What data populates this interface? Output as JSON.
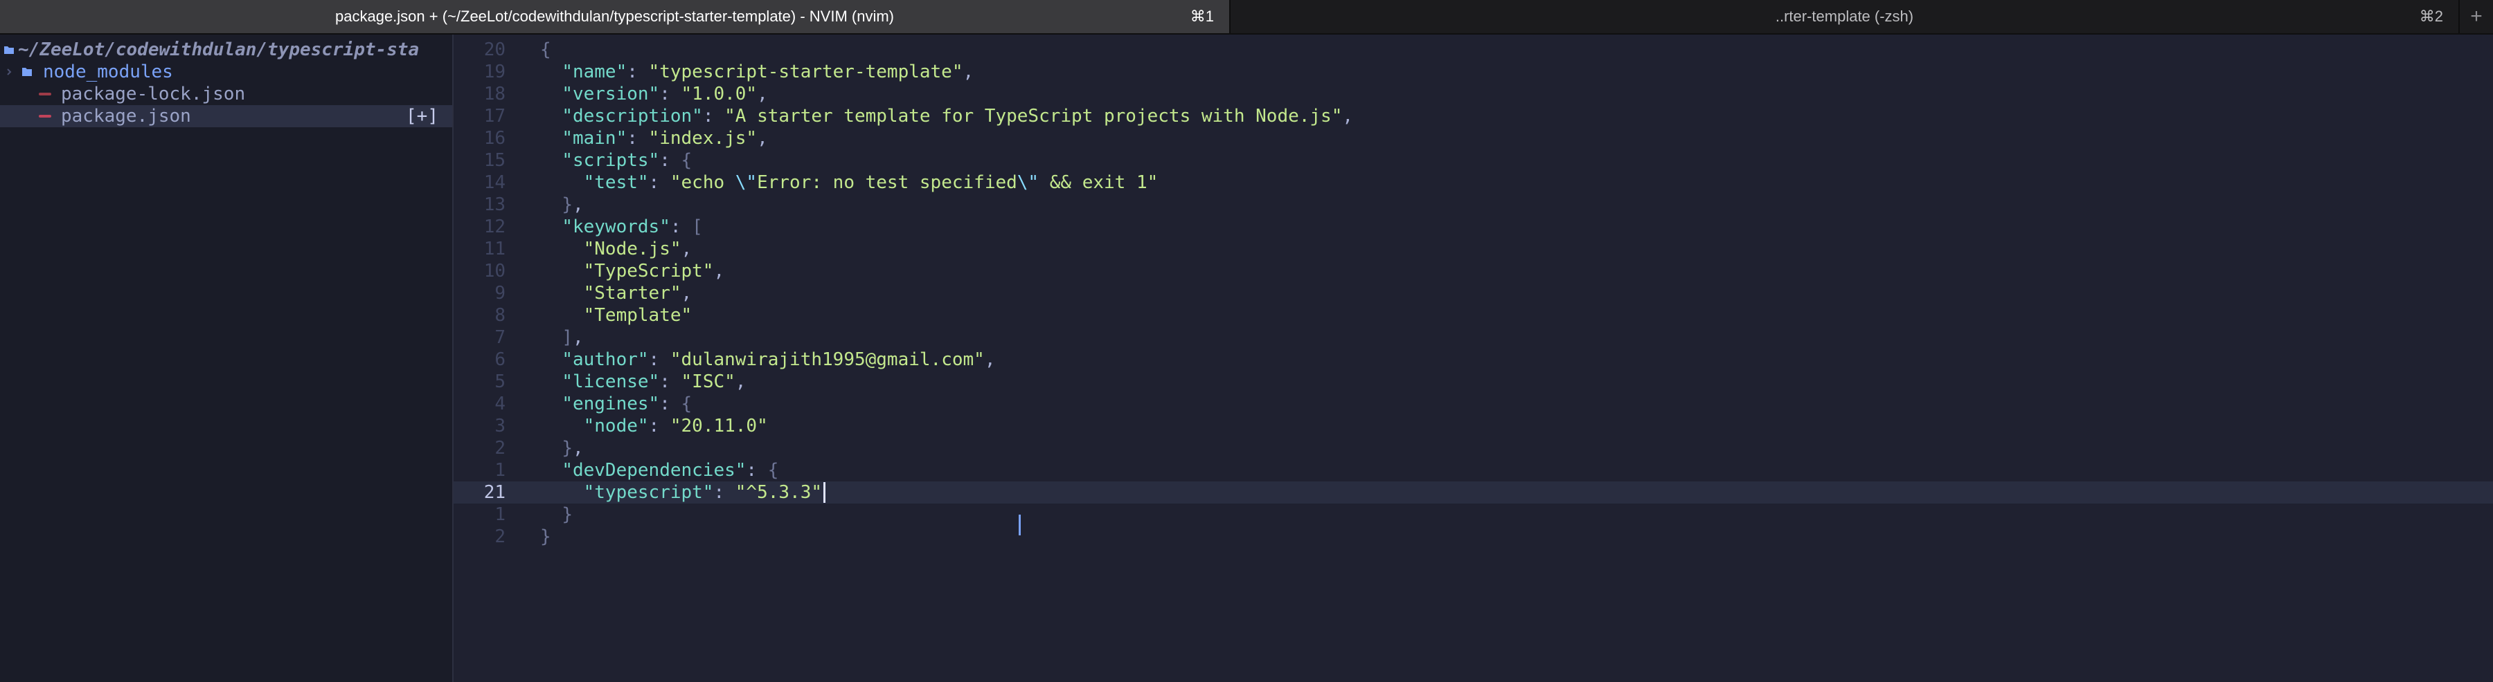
{
  "tabs": [
    {
      "title": "package.json + (~/ZeeLot/codewithdulan/typescript-starter-template) - NVIM (nvim)",
      "shortcut": "⌘1"
    },
    {
      "title": "..rter-template (-zsh)",
      "shortcut": "⌘2"
    }
  ],
  "new_tab": "+",
  "sidebar": {
    "root_path": "~/ZeeLot/codewithdulan/typescript-sta",
    "items": [
      {
        "name": "node_modules",
        "type": "folder"
      },
      {
        "name": "package-lock.json",
        "type": "file"
      },
      {
        "name": "package.json",
        "type": "file",
        "modified_flag": "[+]"
      }
    ]
  },
  "editor": {
    "lines": [
      {
        "num": "20",
        "text": "{"
      },
      {
        "num": "19",
        "text": "  \"name\": \"typescript-starter-template\","
      },
      {
        "num": "18",
        "text": "  \"version\": \"1.0.0\","
      },
      {
        "num": "17",
        "text": "  \"description\": \"A starter template for TypeScript projects with Node.js\","
      },
      {
        "num": "16",
        "text": "  \"main\": \"index.js\","
      },
      {
        "num": "15",
        "text": "  \"scripts\": {"
      },
      {
        "num": "14",
        "text": "    \"test\": \"echo \\\"Error: no test specified\\\" && exit 1\""
      },
      {
        "num": "13",
        "text": "  },"
      },
      {
        "num": "12",
        "text": "  \"keywords\": ["
      },
      {
        "num": "11",
        "text": "    \"Node.js\","
      },
      {
        "num": "10",
        "text": "    \"TypeScript\","
      },
      {
        "num": "9",
        "text": "    \"Starter\","
      },
      {
        "num": "8",
        "text": "    \"Template\""
      },
      {
        "num": "7",
        "text": "  ],"
      },
      {
        "num": "6",
        "text": "  \"author\": \"dulanwirajith1995@gmail.com\","
      },
      {
        "num": "5",
        "text": "  \"license\": \"ISC\","
      },
      {
        "num": "4",
        "text": "  \"engines\": {"
      },
      {
        "num": "3",
        "text": "    \"node\": \"20.11.0\""
      },
      {
        "num": "2",
        "text": "  },"
      },
      {
        "num": "1",
        "text": "  \"devDependencies\": {"
      },
      {
        "num": "21",
        "text": "    \"typescript\": \"^5.3.3\"",
        "current": true
      },
      {
        "num": "1",
        "text": "  }"
      },
      {
        "num": "2",
        "text": "}"
      }
    ]
  },
  "colors": {
    "key": "#73daca",
    "string": "#c3e88d",
    "folder": "#7aa2f7",
    "background": "#1f2130"
  }
}
